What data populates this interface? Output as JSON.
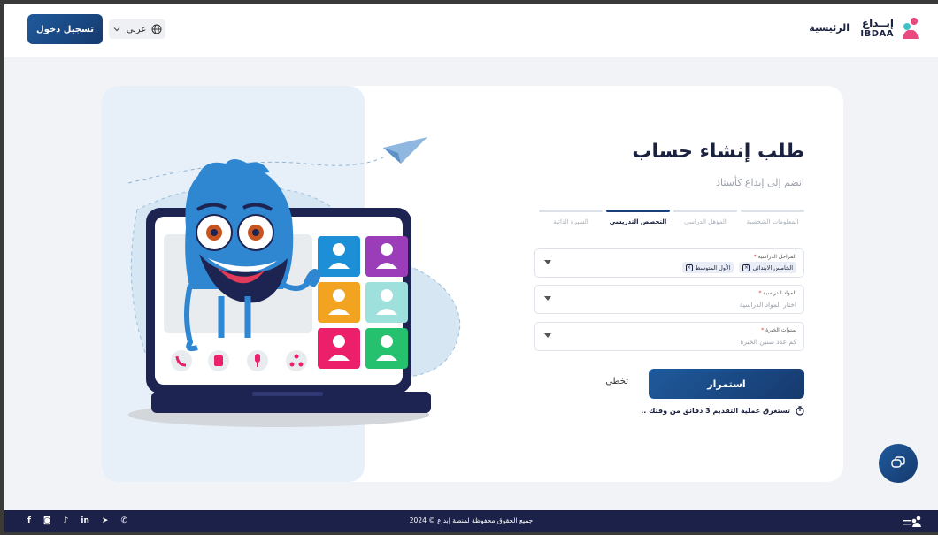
{
  "header": {
    "brand_ar": "إبــداع",
    "brand_en": "IBDAA",
    "home_label": "الرئيسية",
    "login_label": "تسجيل دخول",
    "language_label": "عربي",
    "globe_icon": "globe-icon",
    "chevron_icon": "chevron-down-icon"
  },
  "form": {
    "title": "طلب إنشاء حساب",
    "subtitle": "انضم إلى إبداع كأستاذ",
    "steps": [
      {
        "label": "المعلومات الشخصية",
        "active": false
      },
      {
        "label": "المؤهل الدراسي",
        "active": false
      },
      {
        "label": "التخصص التدريسي",
        "active": true
      },
      {
        "label": "السيرة الذاتية",
        "active": false
      }
    ],
    "fields": {
      "stages": {
        "label": "المراحل الدراسية",
        "required_mark": "*",
        "chips": [
          "الخامس الابتدائي",
          "الأول المتوسط"
        ]
      },
      "subjects": {
        "label": "المواد الدراسية",
        "required_mark": "*",
        "placeholder": "اختار المواد الدراسية"
      },
      "experience": {
        "label": "سنوات الخبرة",
        "required_mark": "*",
        "placeholder": "كم عدد سنين الخبرة"
      }
    },
    "continue_label": "استمرار",
    "skip_label": "تخطي",
    "note": "تستغرق عملية التقديم 3 دقائق من وقتك .."
  },
  "footer": {
    "copyright": "جميع الحقوق محفوظة لمنصة إبداع © 2024",
    "socials": [
      {
        "icon": "facebook-icon",
        "glyph": "f"
      },
      {
        "icon": "instagram-icon",
        "glyph": "◙"
      },
      {
        "icon": "tiktok-icon",
        "glyph": "♪"
      },
      {
        "icon": "linkedin-icon",
        "glyph": "in"
      },
      {
        "icon": "telegram-icon",
        "glyph": "➤"
      },
      {
        "icon": "whatsapp-icon",
        "glyph": "✆"
      }
    ]
  },
  "colors": {
    "brand_navy": "#1b2240",
    "accent_blue": "#1f5a9c",
    "brand_pink": "#e84a7f",
    "brand_teal": "#3fc1c9"
  }
}
